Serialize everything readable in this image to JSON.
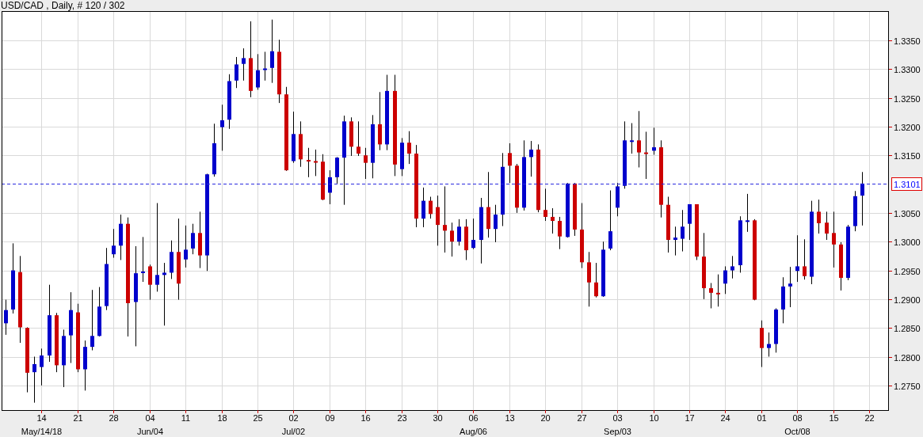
{
  "title": "USD/CAD , Daily, # 120 / 302",
  "chart": {
    "chart_data": {
      "type": "candlestick",
      "grid": true,
      "ylim": [
        1.27071,
        1.34008
      ],
      "yticks": [
        {
          "value": 1.275,
          "label": "1.2750"
        },
        {
          "value": 1.28,
          "label": "1.2800"
        },
        {
          "value": 1.285,
          "label": "1.2850"
        },
        {
          "value": 1.29,
          "label": "1.2900"
        },
        {
          "value": 1.295,
          "label": "1.2950"
        },
        {
          "value": 1.3,
          "label": "1.3000"
        },
        {
          "value": 1.305,
          "label": "1.3050"
        },
        {
          "value": 1.315,
          "label": "1.3150"
        },
        {
          "value": 1.32,
          "label": "1.3200"
        },
        {
          "value": 1.325,
          "label": "1.3250"
        },
        {
          "value": 1.33,
          "label": "1.3300"
        },
        {
          "value": 1.335,
          "label": "1.3350"
        }
      ],
      "categories": [
        null,
        null,
        null,
        null,
        null,
        "14\nMay/14/18",
        null,
        null,
        null,
        null,
        "21",
        null,
        null,
        null,
        null,
        "28",
        null,
        null,
        null,
        null,
        "04\nJun/04",
        null,
        null,
        null,
        null,
        "11",
        null,
        null,
        null,
        null,
        "18",
        null,
        null,
        null,
        null,
        "25",
        null,
        null,
        null,
        null,
        "02\nJul/02",
        null,
        null,
        null,
        null,
        "09",
        null,
        null,
        null,
        null,
        "16",
        null,
        null,
        null,
        null,
        "23",
        null,
        null,
        null,
        null,
        "30",
        null,
        null,
        null,
        null,
        "06\nAug/06",
        null,
        null,
        null,
        null,
        "13",
        null,
        null,
        null,
        null,
        "20",
        null,
        null,
        null,
        null,
        "27",
        null,
        null,
        null,
        null,
        "03\nSep/03",
        null,
        null,
        null,
        null,
        "10",
        null,
        null,
        null,
        null,
        "17",
        null,
        null,
        null,
        null,
        "24",
        null,
        null,
        null,
        null,
        "01",
        null,
        null,
        null,
        null,
        "08\nOct/08",
        null,
        null,
        null,
        null,
        "15",
        null,
        null,
        null,
        null,
        "22"
      ],
      "ref_lines": [
        {
          "axis": "y",
          "value": 1.3101,
          "label": "1.3101"
        }
      ],
      "ohlc": [
        [
          1.2858,
          1.2899,
          1.2838,
          1.2881
        ],
        [
          1.2882,
          1.2997,
          1.2875,
          1.295
        ],
        [
          1.2947,
          1.2975,
          1.2824,
          1.2851
        ],
        [
          1.285,
          1.2851,
          1.2738,
          1.2772
        ],
        [
          1.2773,
          1.28,
          1.272,
          1.2787
        ],
        [
          1.2782,
          1.2814,
          1.275,
          1.2802
        ],
        [
          1.2802,
          1.2925,
          1.2791,
          1.2872
        ],
        [
          1.2872,
          1.2876,
          1.2773,
          1.2785
        ],
        [
          1.2785,
          1.2847,
          1.2747,
          1.2836
        ],
        [
          1.2837,
          1.2912,
          1.2789,
          1.2881
        ],
        [
          1.2877,
          1.2892,
          1.2773,
          1.2778
        ],
        [
          1.2778,
          1.2828,
          1.2741,
          1.2817
        ],
        [
          1.2817,
          1.2916,
          1.2811,
          1.2836
        ],
        [
          1.2836,
          1.2921,
          1.2835,
          1.2887
        ],
        [
          1.2888,
          1.2989,
          1.2881,
          1.2961
        ],
        [
          1.2978,
          1.3022,
          1.2972,
          1.2993
        ],
        [
          1.2993,
          1.3047,
          1.2968,
          1.3031
        ],
        [
          1.3031,
          1.3042,
          1.2835,
          1.2893
        ],
        [
          1.2895,
          1.2992,
          1.2818,
          1.2945
        ],
        [
          1.2946,
          1.3008,
          1.293,
          1.2948
        ],
        [
          1.2957,
          1.296,
          1.2899,
          1.2925
        ],
        [
          1.2925,
          1.3067,
          1.2913,
          1.2942
        ],
        [
          1.2942,
          1.2963,
          1.2854,
          1.2946
        ],
        [
          1.2946,
          1.3002,
          1.2935,
          1.2982
        ],
        [
          1.2982,
          1.304,
          1.2899,
          1.2927
        ],
        [
          1.2969,
          1.3028,
          1.2955,
          1.2986
        ],
        [
          1.2988,
          1.3031,
          1.2978,
          1.3015
        ],
        [
          1.3015,
          1.3052,
          1.2954,
          1.2976
        ],
        [
          1.2976,
          1.3118,
          1.2949,
          1.3117
        ],
        [
          1.3117,
          1.3205,
          1.3113,
          1.3171
        ],
        [
          1.3199,
          1.3238,
          1.3158,
          1.3211
        ],
        [
          1.3212,
          1.3291,
          1.3196,
          1.3279
        ],
        [
          1.328,
          1.3321,
          1.3267,
          1.3308
        ],
        [
          1.3309,
          1.3336,
          1.328,
          1.3319
        ],
        [
          1.3319,
          1.3383,
          1.3251,
          1.3262
        ],
        [
          1.3268,
          1.3326,
          1.3264,
          1.3298
        ],
        [
          1.3299,
          1.333,
          1.328,
          1.3301
        ],
        [
          1.3302,
          1.3386,
          1.3276,
          1.3331
        ],
        [
          1.333,
          1.3351,
          1.3241,
          1.3256
        ],
        [
          1.3256,
          1.3269,
          1.3123,
          1.3124
        ],
        [
          1.314,
          1.3226,
          1.3137,
          1.3187
        ],
        [
          1.3187,
          1.3209,
          1.313,
          1.3143
        ],
        [
          1.3142,
          1.3163,
          1.3112,
          1.314
        ],
        [
          1.314,
          1.316,
          1.3114,
          1.3139
        ],
        [
          1.3139,
          1.3152,
          1.3072,
          1.3073
        ],
        [
          1.3085,
          1.3124,
          1.3065,
          1.3112
        ],
        [
          1.3112,
          1.3147,
          1.3101,
          1.3146
        ],
        [
          1.3146,
          1.3219,
          1.3064,
          1.3209
        ],
        [
          1.3209,
          1.3216,
          1.3149,
          1.3165
        ],
        [
          1.3165,
          1.3209,
          1.3149,
          1.3153
        ],
        [
          1.315,
          1.3163,
          1.3109,
          1.3137
        ],
        [
          1.3137,
          1.322,
          1.311,
          1.3204
        ],
        [
          1.3204,
          1.326,
          1.3159,
          1.3169
        ],
        [
          1.3169,
          1.329,
          1.3159,
          1.3262
        ],
        [
          1.3262,
          1.329,
          1.3114,
          1.3134
        ],
        [
          1.3126,
          1.318,
          1.3114,
          1.3172
        ],
        [
          1.3172,
          1.3192,
          1.3135,
          1.3153
        ],
        [
          1.3153,
          1.3168,
          1.3025,
          1.304
        ],
        [
          1.304,
          1.3094,
          1.3025,
          1.3071
        ],
        [
          1.3071,
          1.3078,
          1.304,
          1.3048
        ],
        [
          1.306,
          1.308,
          1.2993,
          1.3029
        ],
        [
          1.3029,
          1.3096,
          1.2981,
          1.3019
        ],
        [
          1.3019,
          1.3033,
          1.2974,
          1.3
        ],
        [
          1.3,
          1.3039,
          1.2993,
          1.3026
        ],
        [
          1.3026,
          1.3039,
          1.2968,
          1.2985
        ],
        [
          1.2989,
          1.304,
          1.2987,
          1.3003
        ],
        [
          1.3003,
          1.3076,
          1.2962,
          1.306
        ],
        [
          1.306,
          1.3121,
          1.3007,
          1.3022
        ],
        [
          1.3022,
          1.3064,
          1.2999,
          1.3047
        ],
        [
          1.3047,
          1.3154,
          1.3027,
          1.313
        ],
        [
          1.3154,
          1.3171,
          1.3102,
          1.3132
        ],
        [
          1.3132,
          1.3135,
          1.305,
          1.3059
        ],
        [
          1.3059,
          1.3176,
          1.3054,
          1.3147
        ],
        [
          1.3147,
          1.3175,
          1.3113,
          1.316
        ],
        [
          1.316,
          1.3169,
          1.3051,
          1.3055
        ],
        [
          1.3055,
          1.3092,
          1.3036,
          1.3043
        ],
        [
          1.3043,
          1.3058,
          1.3014,
          1.3036
        ],
        [
          1.3036,
          1.3043,
          1.2987,
          1.3009
        ],
        [
          1.3008,
          1.3102,
          1.3007,
          1.3101
        ],
        [
          1.3101,
          1.3102,
          1.301,
          1.3021
        ],
        [
          1.3021,
          1.3067,
          1.2954,
          1.2964
        ],
        [
          1.2964,
          1.2982,
          1.2887,
          1.2929
        ],
        [
          1.2929,
          1.2963,
          1.2903,
          1.2905
        ],
        [
          1.2905,
          1.3,
          1.2904,
          1.2986
        ],
        [
          1.2988,
          1.3089,
          1.2985,
          1.3018
        ],
        [
          1.3059,
          1.3102,
          1.3044,
          1.3096
        ],
        [
          1.3097,
          1.3209,
          1.3092,
          1.3176
        ],
        [
          1.3175,
          1.3206,
          1.3153,
          1.3176
        ],
        [
          1.3176,
          1.3227,
          1.3129,
          1.3155
        ],
        [
          1.3155,
          1.3191,
          1.3109,
          1.3153
        ],
        [
          1.3158,
          1.3198,
          1.3151,
          1.3164
        ],
        [
          1.3164,
          1.3176,
          1.3042,
          1.3064
        ],
        [
          1.3064,
          1.3078,
          1.2981,
          1.3003
        ],
        [
          1.3003,
          1.3026,
          1.2976,
          1.3007
        ],
        [
          1.3005,
          1.3055,
          1.2983,
          1.3026
        ],
        [
          1.3031,
          1.3065,
          1.3003,
          1.3065
        ],
        [
          1.3065,
          1.3065,
          1.2968,
          1.2974
        ],
        [
          1.2974,
          1.3015,
          1.29,
          1.2919
        ],
        [
          1.2919,
          1.2928,
          1.2884,
          1.2911
        ],
        [
          1.2911,
          1.2943,
          1.2887,
          1.291
        ],
        [
          1.2927,
          1.2957,
          1.2909,
          1.295
        ],
        [
          1.295,
          1.2975,
          1.2936,
          1.2957
        ],
        [
          1.2959,
          1.3044,
          1.2946,
          1.3037
        ],
        [
          1.3036,
          1.3083,
          1.3017,
          1.3037
        ],
        [
          1.3037,
          1.3039,
          1.2898,
          1.2899
        ],
        [
          1.285,
          1.2863,
          1.2782,
          1.2815
        ],
        [
          1.2815,
          1.2842,
          1.28,
          1.2822
        ],
        [
          1.2822,
          1.2884,
          1.2807,
          1.2882
        ],
        [
          1.2882,
          1.2938,
          1.2858,
          1.2922
        ],
        [
          1.2922,
          1.2956,
          1.2886,
          1.2927
        ],
        [
          1.2949,
          1.3011,
          1.293,
          1.2957
        ],
        [
          1.2957,
          1.3004,
          1.2934,
          1.294
        ],
        [
          1.2939,
          1.3071,
          1.2926,
          1.3052
        ],
        [
          1.3052,
          1.3073,
          1.3014,
          1.3032
        ],
        [
          1.3033,
          1.3052,
          1.3003,
          1.3014
        ],
        [
          1.3015,
          1.3052,
          1.2955,
          1.2995
        ],
        [
          1.2995,
          1.2999,
          1.2915,
          1.2937
        ],
        [
          1.2937,
          1.3029,
          1.2933,
          1.3026
        ],
        [
          1.3027,
          1.3088,
          1.3018,
          1.3079
        ],
        [
          1.308,
          1.3121,
          1.3028,
          1.3101
        ],
        null
      ]
    }
  }
}
